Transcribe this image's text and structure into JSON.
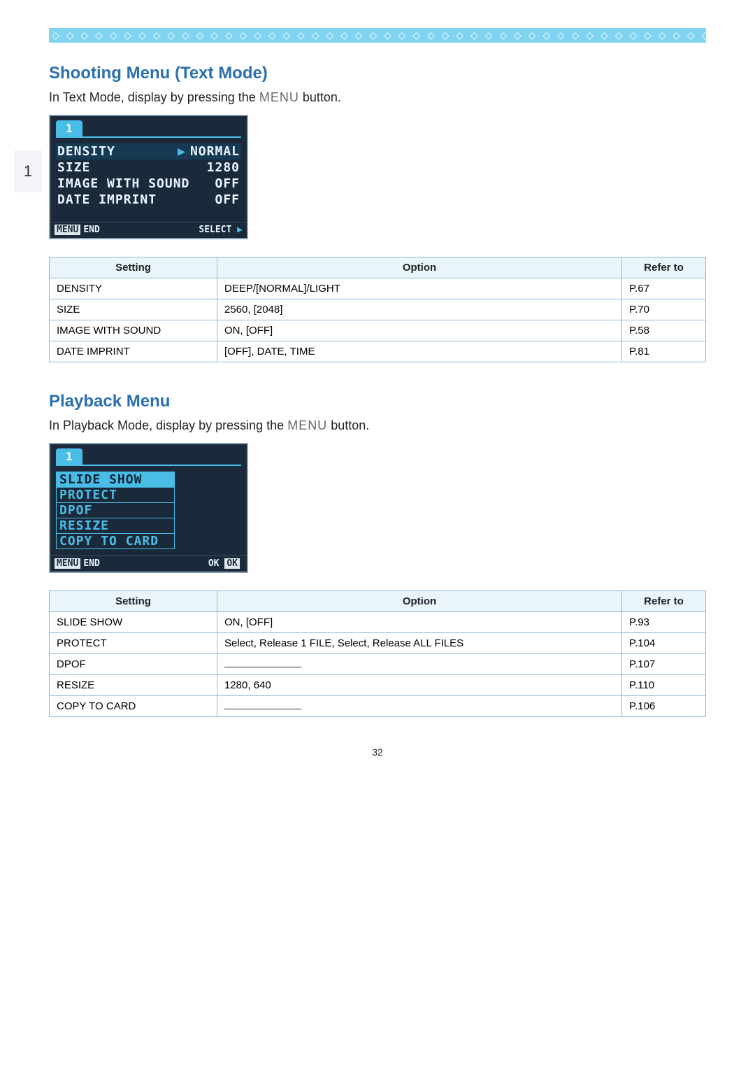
{
  "page_number": "32",
  "sidebar_tab": "1",
  "diamond_row": "◇ ◇ ◇ ◇ ◇ ◇ ◇ ◇ ◇ ◇ ◇ ◇ ◇ ◇ ◇ ◇ ◇ ◇ ◇ ◇ ◇ ◇ ◇ ◇ ◇ ◇ ◇ ◇ ◇ ◇ ◇ ◇ ◇ ◇ ◇ ◇ ◇ ◇ ◇ ◇ ◇ ◇ ◇ ◇ ◇ ◇ ◇ ◇ ◇ ◇ ◇ ◇ ◇ ◇ ◇",
  "shooting": {
    "title": "Shooting Menu (Text Mode)",
    "intro_pre": "In Text Mode, display by pressing the ",
    "intro_menu": "MENU",
    "intro_post": " button.",
    "lcd": {
      "tab": "1",
      "rows": [
        {
          "label": "DENSITY",
          "value": "NORMAL",
          "selected": true
        },
        {
          "label": "SIZE",
          "value": "1280",
          "selected": false
        },
        {
          "label": "IMAGE WITH SOUND",
          "value": "OFF",
          "selected": false
        },
        {
          "label": "DATE IMPRINT",
          "value": "OFF",
          "selected": false
        }
      ],
      "footer_left_box": "MENU",
      "footer_left_text": "END",
      "footer_right_text": "SELECT",
      "footer_right_tri": "▶"
    },
    "table": {
      "headers": {
        "setting": "Setting",
        "option": "Option",
        "refer": "Refer to"
      },
      "rows": [
        {
          "setting": "DENSITY",
          "option": "DEEP/[NORMAL]/LIGHT",
          "refer": "P.67"
        },
        {
          "setting": "SIZE",
          "option": "2560, [2048]",
          "refer": "P.70"
        },
        {
          "setting": "IMAGE WITH SOUND",
          "option": "ON, [OFF]",
          "refer": "P.58"
        },
        {
          "setting": "DATE IMPRINT",
          "option": "[OFF], DATE, TIME",
          "refer": "P.81"
        }
      ]
    }
  },
  "playback": {
    "title": "Playback Menu",
    "intro_pre": "In Playback Mode, display by pressing the ",
    "intro_menu": "MENU",
    "intro_post": " button.",
    "lcd": {
      "tab": "1",
      "items": [
        {
          "label": "SLIDE SHOW",
          "selected": true
        },
        {
          "label": "PROTECT",
          "selected": false
        },
        {
          "label": "DPOF",
          "selected": false
        },
        {
          "label": "RESIZE",
          "selected": false
        },
        {
          "label": "COPY TO CARD",
          "selected": false
        }
      ],
      "footer_left_box": "MENU",
      "footer_left_text": "END",
      "footer_right_text": "OK",
      "footer_right_box": "OK"
    },
    "table": {
      "headers": {
        "setting": "Setting",
        "option": "Option",
        "refer": "Refer to"
      },
      "rows": [
        {
          "setting": "SLIDE SHOW",
          "option": "ON, [OFF]",
          "refer": "P.93"
        },
        {
          "setting": "PROTECT",
          "option": "Select, Release 1 FILE, Select, Release ALL FILES",
          "refer": "P.104"
        },
        {
          "setting": "DPOF",
          "option": "",
          "refer": "P.107"
        },
        {
          "setting": "RESIZE",
          "option": "1280, 640",
          "refer": "P.110"
        },
        {
          "setting": "COPY TO CARD",
          "option": "",
          "refer": "P.106"
        }
      ]
    }
  }
}
